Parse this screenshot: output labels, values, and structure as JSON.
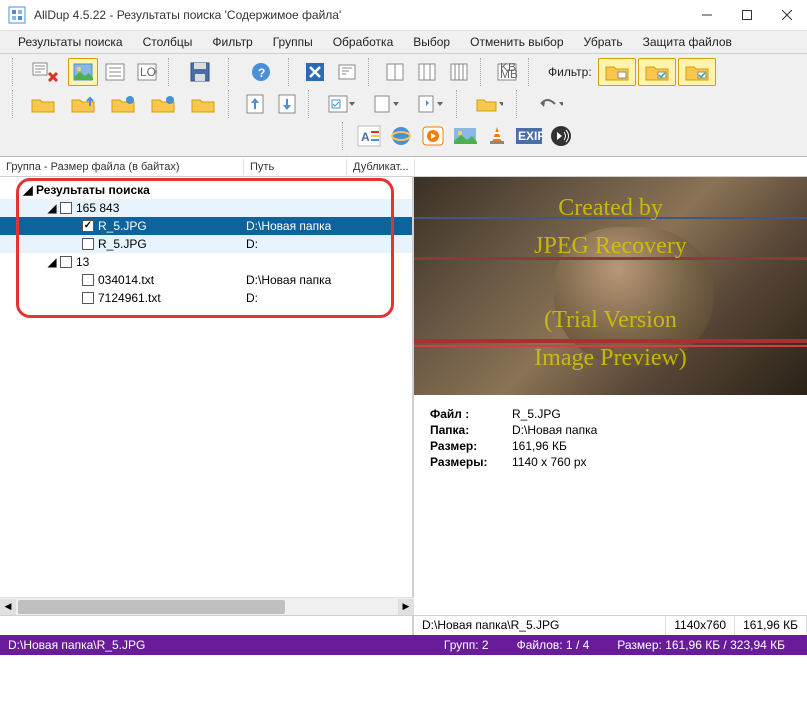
{
  "window": {
    "title": "AllDup 4.5.22 - Результаты поиска 'Содержимое файла'"
  },
  "menu": {
    "results": "Результаты поиска",
    "columns": "Столбцы",
    "filter": "Фильтр",
    "groups": "Группы",
    "process": "Обработка",
    "select": "Выбор",
    "deselect": "Отменить выбор",
    "remove": "Убрать",
    "protect": "Защита файлов"
  },
  "filter_label": "Фильтр:",
  "columns_header": {
    "col1": "Группа - Размер файла (в байтах)",
    "col2": "Путь",
    "col3": "Дубликат..."
  },
  "tree": {
    "root": "Результаты поиска",
    "groups": [
      {
        "label": "165 843",
        "checked": false,
        "files": [
          {
            "name": "R_5.JPG",
            "path": "D:\\Новая папка",
            "checked": true,
            "selected": true
          },
          {
            "name": "R_5.JPG",
            "path": "D:",
            "checked": false,
            "selected": false
          }
        ]
      },
      {
        "label": "13",
        "checked": false,
        "files": [
          {
            "name": "034014.txt",
            "path": "D:\\Новая папка",
            "checked": false,
            "selected": false
          },
          {
            "name": "7124961.txt",
            "path": "D:",
            "checked": false,
            "selected": false
          }
        ]
      }
    ]
  },
  "preview_watermark": {
    "l1": "Created by",
    "l2": "JPEG Recovery",
    "l3": "(Trial Version",
    "l4": "Image Preview)"
  },
  "details": {
    "file_label": "Файл :",
    "file_value": "R_5.JPG",
    "folder_label": "Папка:",
    "folder_value": "D:\\Новая папка",
    "size_label": "Размер:",
    "size_value": "161,96 КБ",
    "dims_label": "Размеры:",
    "dims_value": "1140 x 760 px"
  },
  "bottom": {
    "right_path": "D:\\Новая папка\\R_5.JPG",
    "dims": "1140x760",
    "fsize": "161,96 КБ"
  },
  "purple": {
    "path": "D:\\Новая папка\\R_5.JPG",
    "groups": "Групп: 2",
    "files": "Файлов: 1 / 4",
    "size": "Размер: 161,96 КБ / 323,94 КБ"
  }
}
